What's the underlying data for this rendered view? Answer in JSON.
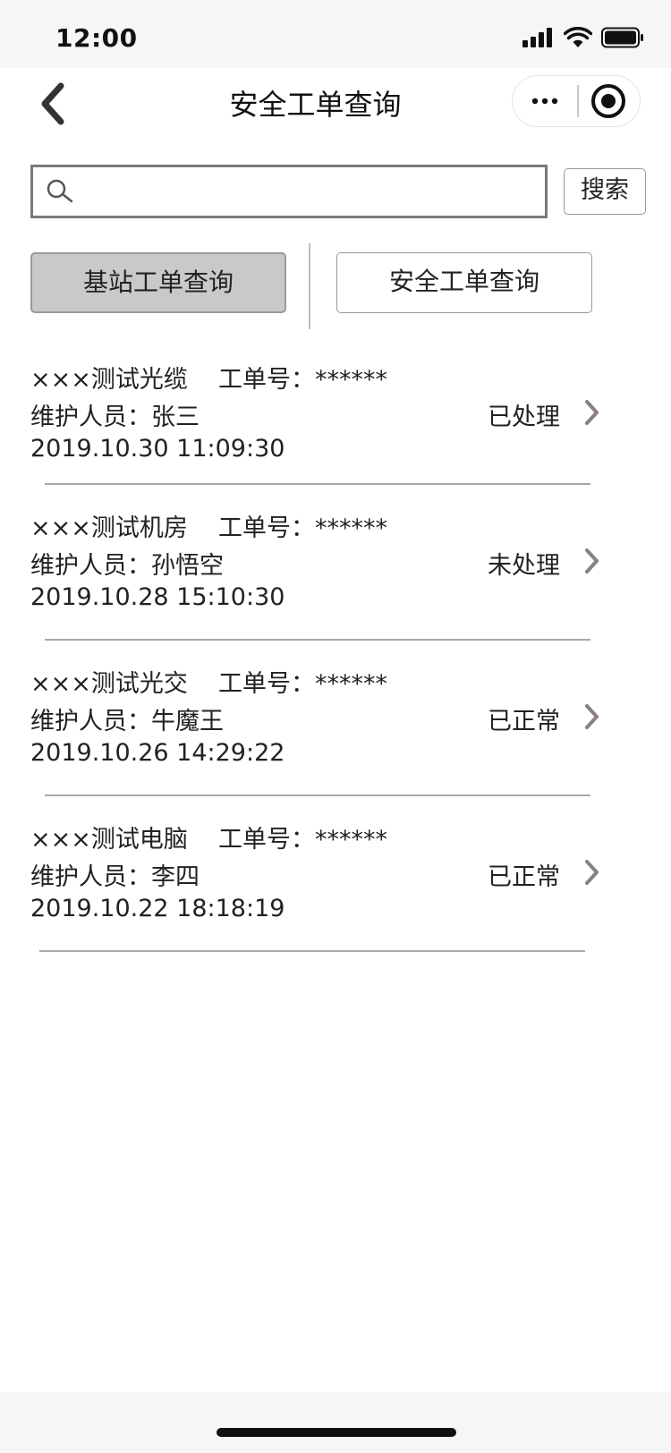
{
  "status_bar": {
    "time": "12:00",
    "icons": [
      "signal-icon",
      "wifi-icon",
      "battery-icon"
    ]
  },
  "nav": {
    "title": "安全工单查询",
    "back_icon": "chevron-left-icon",
    "more_icon": "more-dots-icon",
    "close_icon": "target-close-icon"
  },
  "search": {
    "placeholder": "",
    "value": "",
    "button_label": "搜索"
  },
  "tabs": [
    {
      "label": "基站工单查询",
      "active": true
    },
    {
      "label": "安全工单查询",
      "active": false
    }
  ],
  "work_orders": [
    {
      "name": "×××测试光缆",
      "order_label": "工单号：",
      "order_no": "******",
      "staff_label": "维护人员：",
      "staff": "张三",
      "time": "2019.10.30 11:09:30",
      "status": "已处理"
    },
    {
      "name": "×××测试机房",
      "order_label": "工单号：",
      "order_no": "******",
      "staff_label": "维护人员：",
      "staff": "孙悟空",
      "time": "2019.10.28 15:10:30",
      "status": "未处理"
    },
    {
      "name": "×××测试光交",
      "order_label": "工单号：",
      "order_no": "******",
      "staff_label": "维护人员：",
      "staff": "牛魔王",
      "time": "2019.10.26 14:29:22",
      "status": "已正常"
    },
    {
      "name": "×××测试电脑",
      "order_label": "工单号：",
      "order_no": "******",
      "staff_label": "维护人员：",
      "staff": "李四",
      "time": "2019.10.22 18:18:19",
      "status": "已正常"
    }
  ],
  "colors": {
    "active_tab_bg": "#c9c9c9",
    "border": "#9a9a9a",
    "chevron": "#8a8080",
    "separator": "#a8a8a8"
  }
}
